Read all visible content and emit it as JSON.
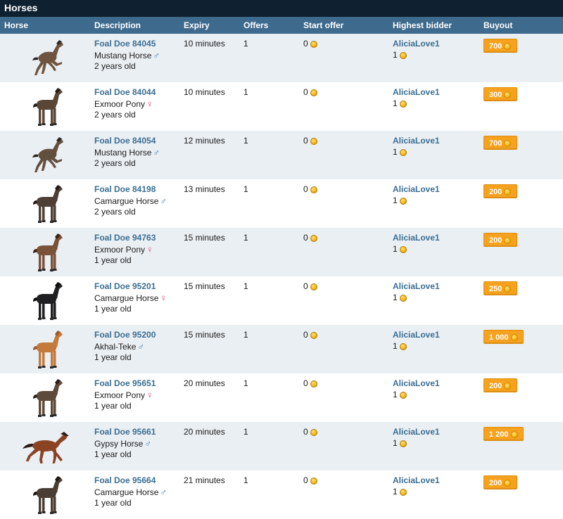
{
  "section_title": "Horses",
  "columns": {
    "horse": "Horse",
    "description": "Description",
    "expiry": "Expiry",
    "offers": "Offers",
    "start_offer": "Start offer",
    "highest_bidder": "Highest bidder",
    "buyout": "Buyout"
  },
  "colors": {
    "title_bar": "#0f2030",
    "header": "#3e6a8d",
    "alt_row": "#eaeff3",
    "link": "#3a6e92",
    "buyout_button": "#f6a21e",
    "male_symbol": "#3b7ab6",
    "female_symbol": "#d24a86"
  },
  "rows": [
    {
      "name": "Foal Doe 84045",
      "breed": "Mustang Horse",
      "sex": "♂",
      "sex_class": "male",
      "age": "2 years old",
      "expiry": "10 minutes",
      "offers": "1",
      "start_offer": "0",
      "bidder": "AliciaLove1",
      "bid": "1",
      "buyout": "700",
      "coat": "#6e5440",
      "mane": "#2d2520",
      "pose": "jump"
    },
    {
      "name": "Foal Doe 84044",
      "breed": "Exmoor Pony",
      "sex": "♀",
      "sex_class": "female",
      "age": "2 years old",
      "expiry": "10 minutes",
      "offers": "1",
      "start_offer": "0",
      "bidder": "AliciaLove1",
      "bid": "1",
      "buyout": "300",
      "coat": "#5a4636",
      "mane": "#241c16",
      "pose": "stand"
    },
    {
      "name": "Foal Doe 84054",
      "breed": "Mustang Horse",
      "sex": "♂",
      "sex_class": "male",
      "age": "2 years old",
      "expiry": "12 minutes",
      "offers": "1",
      "start_offer": "0",
      "bidder": "AliciaLove1",
      "bid": "1",
      "buyout": "700",
      "coat": "#62503f",
      "mane": "#2b231d",
      "pose": "jump"
    },
    {
      "name": "Foal Doe 84198",
      "breed": "Camargue Horse",
      "sex": "♂",
      "sex_class": "male",
      "age": "2 years old",
      "expiry": "13 minutes",
      "offers": "1",
      "start_offer": "0",
      "bidder": "AliciaLove1",
      "bid": "1",
      "buyout": "200",
      "coat": "#4d3f35",
      "mane": "#1e1814",
      "pose": "stand"
    },
    {
      "name": "Foal Doe 94763",
      "breed": "Exmoor Pony",
      "sex": "♀",
      "sex_class": "female",
      "age": "1 year old",
      "expiry": "15 minutes",
      "offers": "1",
      "start_offer": "0",
      "bidder": "AliciaLove1",
      "bid": "1",
      "buyout": "200",
      "coat": "#7a5238",
      "mane": "#3a2418",
      "pose": "stand"
    },
    {
      "name": "Foal Doe 95201",
      "breed": "Camargue Horse",
      "sex": "♀",
      "sex_class": "female",
      "age": "1 year old",
      "expiry": "15 minutes",
      "offers": "1",
      "start_offer": "0",
      "bidder": "AliciaLove1",
      "bid": "1",
      "buyout": "250",
      "coat": "#1f1f22",
      "mane": "#0c0c0e",
      "pose": "stand"
    },
    {
      "name": "Foal Doe 95200",
      "breed": "Akhal-Teke",
      "sex": "♂",
      "sex_class": "male",
      "age": "1 year old",
      "expiry": "15 minutes",
      "offers": "1",
      "start_offer": "0",
      "bidder": "AliciaLove1",
      "bid": "1",
      "buyout": "1 000",
      "coat": "#c47a3c",
      "mane": "#9a5a2a",
      "pose": "stand"
    },
    {
      "name": "Foal Doe 95651",
      "breed": "Exmoor Pony",
      "sex": "♀",
      "sex_class": "female",
      "age": "1 year old",
      "expiry": "20 minutes",
      "offers": "1",
      "start_offer": "0",
      "bidder": "AliciaLove1",
      "bid": "1",
      "buyout": "200",
      "coat": "#5e4a3a",
      "mane": "#251d17",
      "pose": "stand"
    },
    {
      "name": "Foal Doe 95661",
      "breed": "Gypsy Horse",
      "sex": "♂",
      "sex_class": "male",
      "age": "1 year old",
      "expiry": "20 minutes",
      "offers": "1",
      "start_offer": "0",
      "bidder": "AliciaLove1",
      "bid": "1",
      "buyout": "1 200",
      "coat": "#8a4424",
      "mane": "#2a1a12",
      "pose": "trot"
    },
    {
      "name": "Foal Doe 95664",
      "breed": "Camargue Horse",
      "sex": "♂",
      "sex_class": "male",
      "age": "1 year old",
      "expiry": "21 minutes",
      "offers": "1",
      "start_offer": "0",
      "bidder": "AliciaLove1",
      "bid": "1",
      "buyout": "200",
      "coat": "#4a3d33",
      "mane": "#1c1612",
      "pose": "stand"
    }
  ]
}
